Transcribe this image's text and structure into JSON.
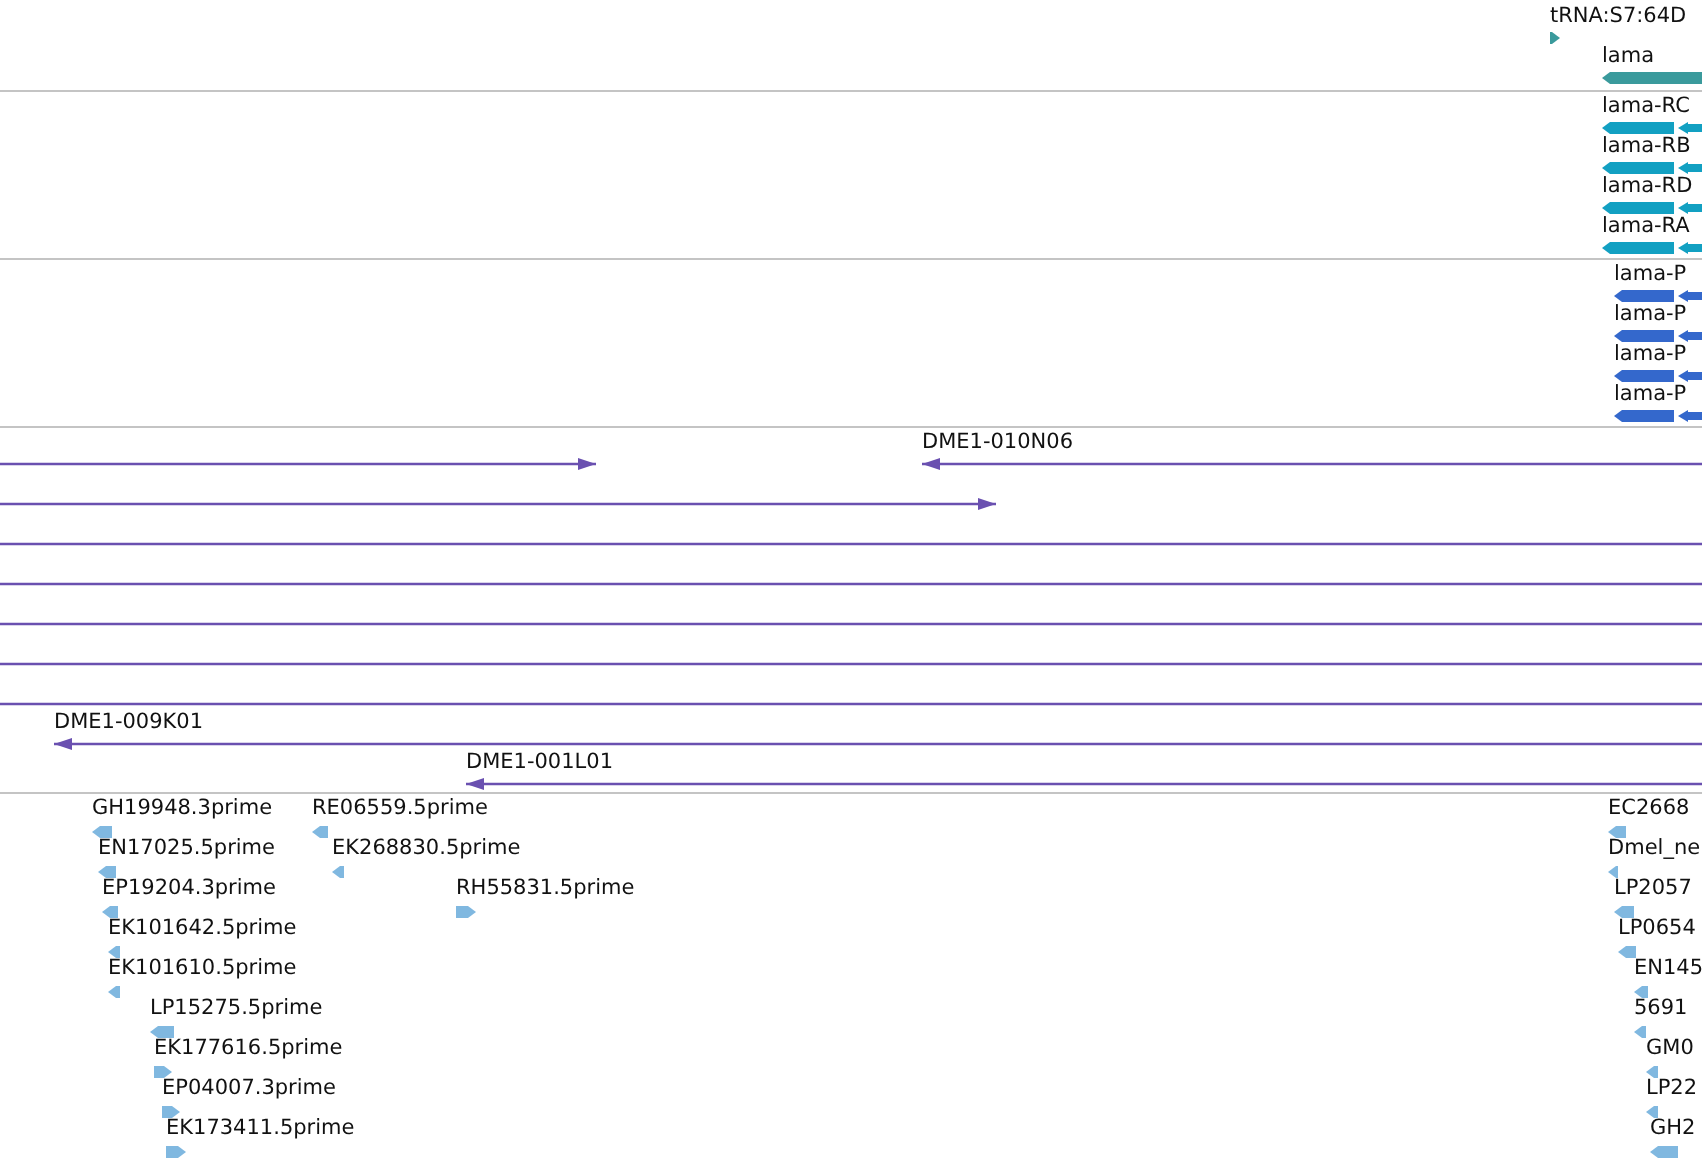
{
  "tracks": [
    {
      "kind": "gene",
      "features": [
        {
          "label": "tRNA:S7:64D",
          "reverse": false
        },
        {
          "label": "lama",
          "reverse": true
        }
      ]
    },
    {
      "kind": "transcript",
      "features": [
        {
          "label": "lama-RC",
          "reverse": true
        },
        {
          "label": "lama-RB",
          "reverse": true
        },
        {
          "label": "lama-RD",
          "reverse": true
        },
        {
          "label": "lama-RA",
          "reverse": true
        }
      ]
    },
    {
      "kind": "protein",
      "features": [
        {
          "label": "lama-P",
          "reverse": true
        },
        {
          "label": "lama-P",
          "reverse": true
        },
        {
          "label": "lama-P",
          "reverse": true
        },
        {
          "label": "lama-P",
          "reverse": true
        }
      ]
    },
    {
      "kind": "clone",
      "features": [
        {
          "reverse": false,
          "arrowhead": true
        },
        {
          "label": "DME1-010N06",
          "reverse": true,
          "arrowhead": true
        },
        {
          "reverse": false,
          "arrowhead": true
        },
        {
          "arrowhead": false
        },
        {
          "arrowhead": false
        },
        {
          "arrowhead": false
        },
        {
          "arrowhead": false
        },
        {
          "arrowhead": false
        },
        {
          "label": "DME1-009K01",
          "reverse": true,
          "arrowhead": true
        },
        {
          "label": "DME1-001L01",
          "reverse": true,
          "arrowhead": true
        }
      ]
    },
    {
      "kind": "est",
      "features": [
        {
          "label": "GH19948.3prime",
          "reverse": true
        },
        {
          "label": "RE06559.5prime",
          "reverse": true
        },
        {
          "label": "EN17025.5prime",
          "reverse": true
        },
        {
          "label": "EK268830.5prime",
          "reverse": true
        },
        {
          "label": "EP19204.3prime",
          "reverse": true
        },
        {
          "label": "RH55831.5prime",
          "reverse": false
        },
        {
          "label": "EK101642.5prime",
          "reverse": true
        },
        {
          "label": "EK101610.5prime",
          "reverse": true
        },
        {
          "label": "LP15275.5prime",
          "reverse": true
        },
        {
          "label": "EK177616.5prime",
          "reverse": false
        },
        {
          "label": "EP04007.3prime",
          "reverse": false
        },
        {
          "label": "EK173411.5prime",
          "reverse": false
        },
        {
          "label": "EC2668",
          "reverse": true
        },
        {
          "label": "Dmel_ne",
          "reverse": true
        },
        {
          "label": "LP2057",
          "reverse": true
        },
        {
          "label": "LP0654",
          "reverse": true
        },
        {
          "label": "EN145",
          "reverse": true
        },
        {
          "label": "5691",
          "reverse": true
        },
        {
          "label": "GM0",
          "reverse": true
        },
        {
          "label": "LP22",
          "reverse": true
        },
        {
          "label": "GH2",
          "reverse": true
        }
      ]
    }
  ]
}
